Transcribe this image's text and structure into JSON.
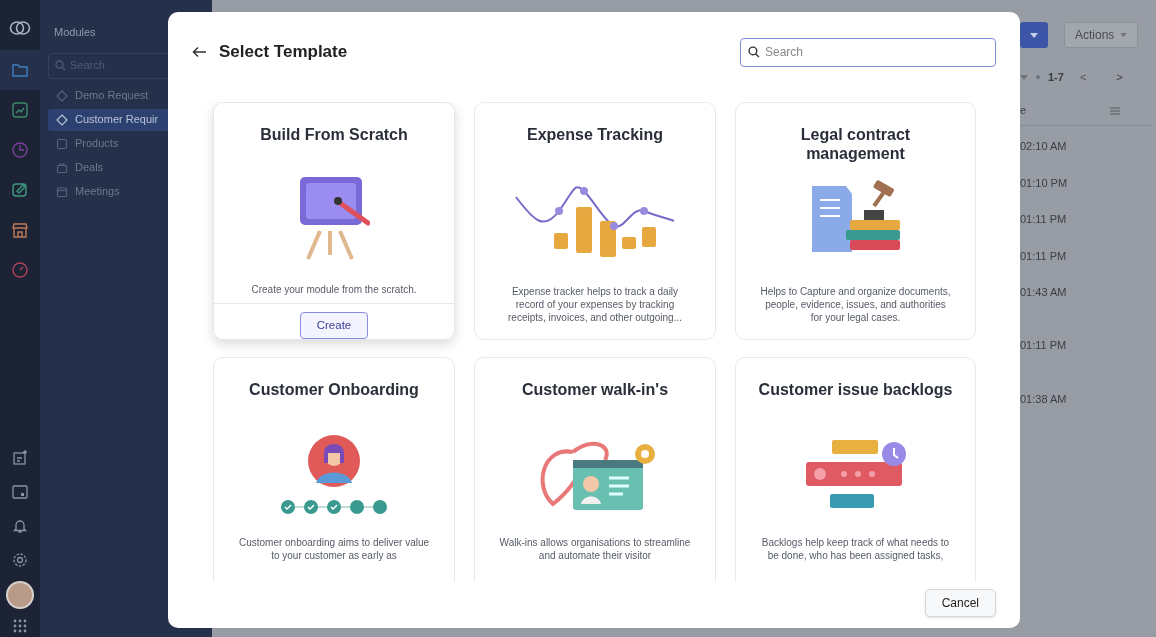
{
  "rail": {
    "items": [
      {
        "kind": "folder",
        "selected": true
      },
      {
        "kind": "chart",
        "selected": false
      },
      {
        "kind": "clock",
        "selected": false
      },
      {
        "kind": "note",
        "selected": false
      },
      {
        "kind": "store",
        "selected": false
      },
      {
        "kind": "gauge",
        "selected": false
      }
    ],
    "bottom": [
      {
        "kind": "note-add"
      },
      {
        "kind": "calendar"
      },
      {
        "kind": "bell"
      },
      {
        "kind": "gear"
      }
    ]
  },
  "modules": {
    "title": "Modules",
    "search": {
      "placeholder": "Search"
    },
    "items": [
      {
        "label": "Demo Request",
        "kind": "diamond",
        "selected": false
      },
      {
        "label": "Customer Requir",
        "kind": "diamond",
        "selected": true
      },
      {
        "label": "Products",
        "kind": "box",
        "selected": false
      },
      {
        "label": "Deals",
        "kind": "bag",
        "selected": false
      },
      {
        "label": "Meetings",
        "kind": "calendar",
        "selected": false
      }
    ]
  },
  "background": {
    "actions_button": "Actions",
    "pagination": "1-7",
    "previous": "<",
    "next": ">",
    "column_header": "e",
    "times": [
      "02:10 AM",
      "01:10 PM",
      "01:11 PM",
      "01:11 PM",
      "01:43 AM",
      "01:11 PM",
      "01:38 AM"
    ]
  },
  "dialog": {
    "title": "Select Template",
    "search": {
      "placeholder": "Search"
    },
    "cards": [
      {
        "kind": "scratch",
        "title": "Build From Scratch",
        "description": "Create your module from the scratch.",
        "hovered": true,
        "button": "Create"
      },
      {
        "kind": "expense",
        "title": "Expense Tracking",
        "description": "Expense tracker helps to track a daily record of your expenses by tracking receipts, invoices, and other outgoing...",
        "hovered": false
      },
      {
        "kind": "legal",
        "title": "Legal contract management",
        "description": "Helps to Capture and organize documents, people, evidence, issues, and authorities for your legal cases.",
        "hovered": false
      },
      {
        "kind": "onboarding",
        "title": "Customer Onboarding",
        "description": "Customer onboarding aims to deliver value to your customer as early as",
        "hovered": false
      },
      {
        "kind": "walkin",
        "title": "Customer walk-in's",
        "description": "Walk-ins allows organisations to streamline and automate their visitor",
        "hovered": false
      },
      {
        "kind": "backlog",
        "title": "Customer issue backlogs",
        "description": "Backlogs help keep track of what needs to be done, who has been assigned tasks,",
        "hovered": false
      }
    ],
    "cancel": "Cancel"
  }
}
